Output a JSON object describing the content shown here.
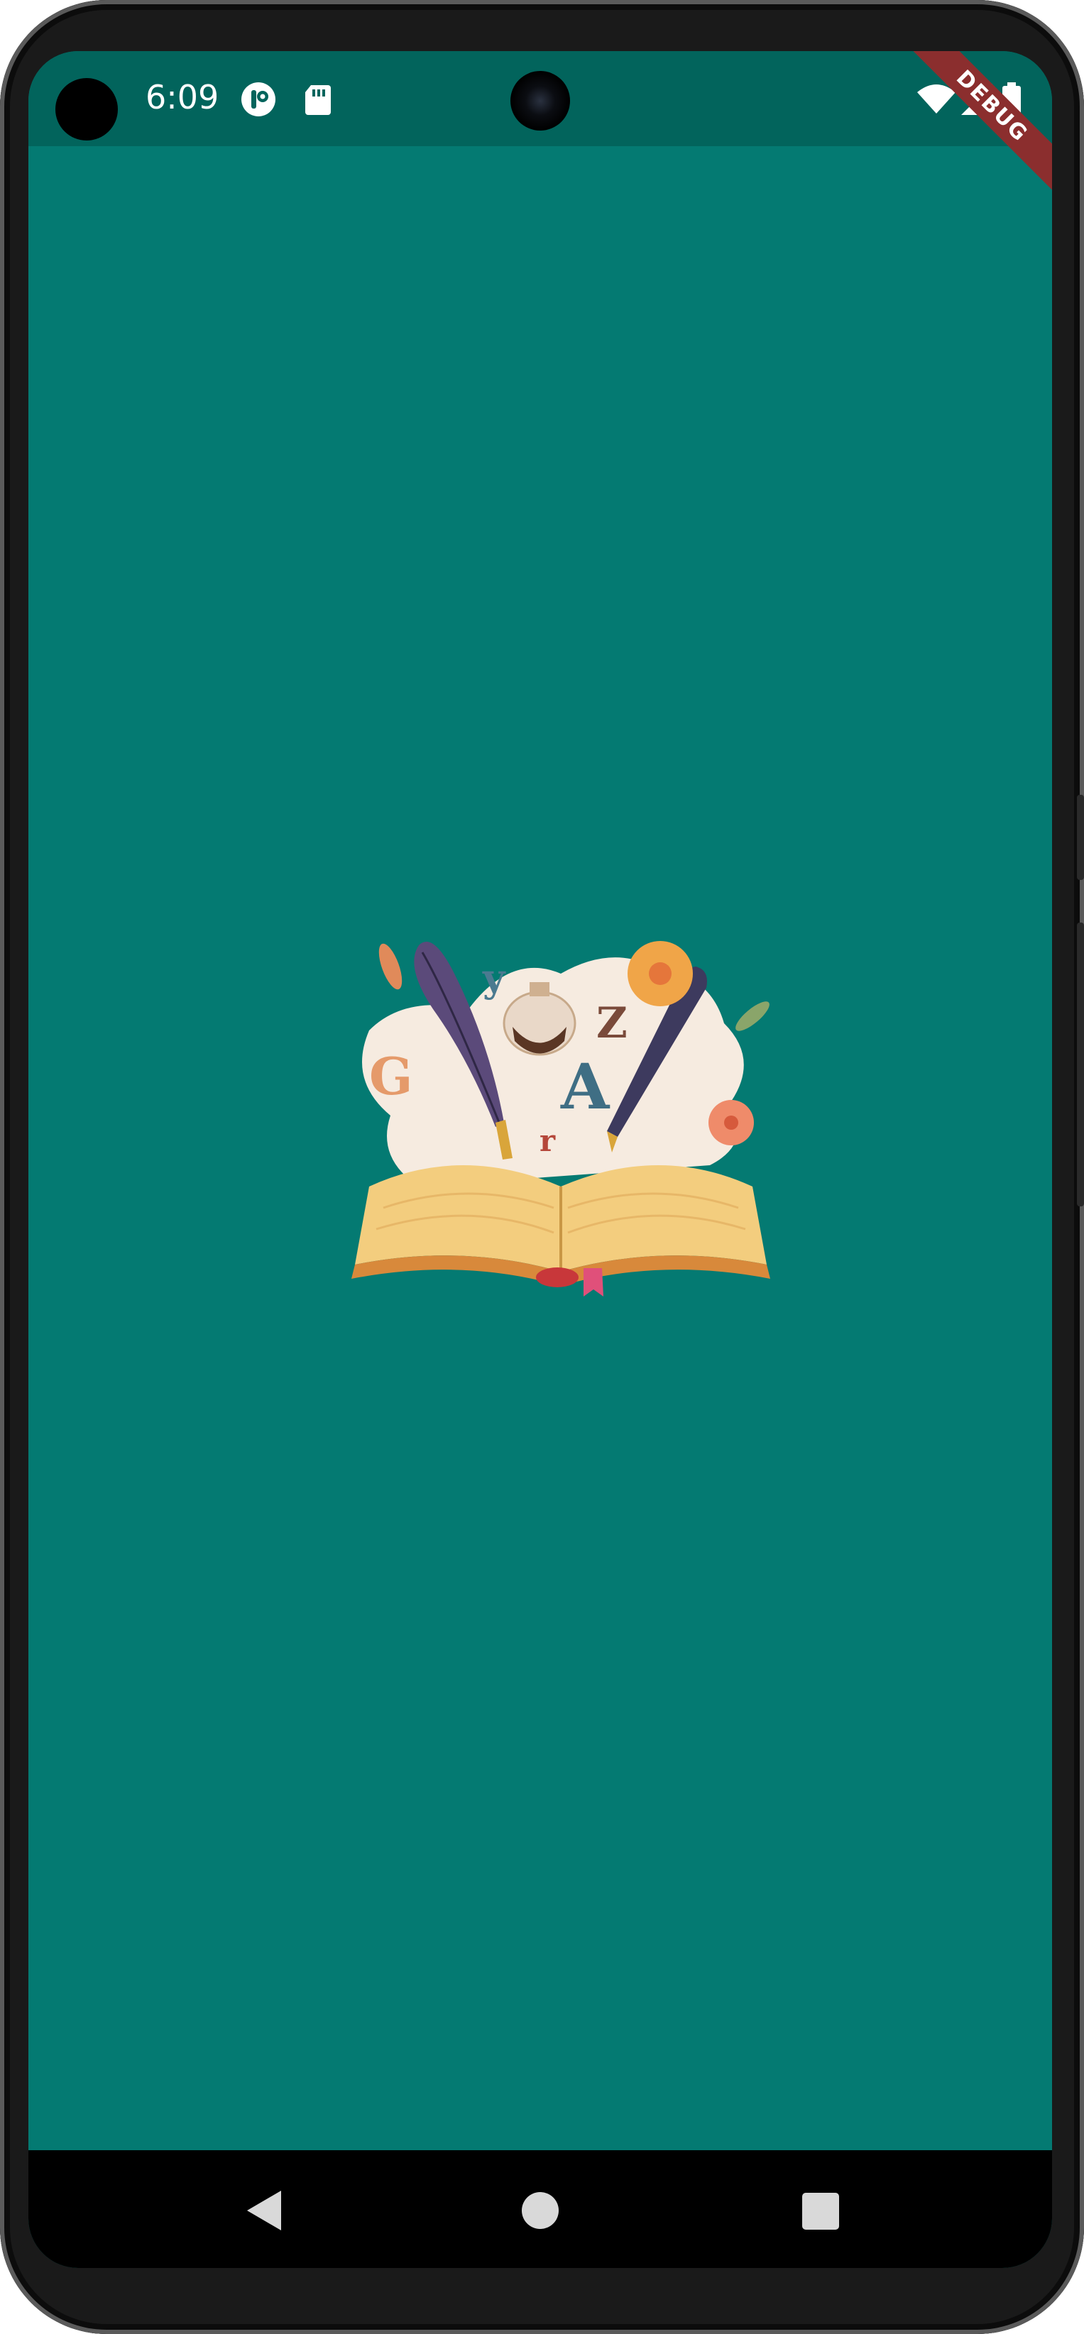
{
  "status_bar": {
    "time": "6:09",
    "icons": [
      "app-notification-icon",
      "sd-card-icon",
      "wifi-icon",
      "signal-icon",
      "battery-icon"
    ],
    "background_color": "#02645c"
  },
  "debug_banner": {
    "label": "DEBUG"
  },
  "screen": {
    "background_color": "#047a72",
    "illustration": {
      "letters": [
        "G",
        "y",
        "Z",
        "A",
        "r"
      ],
      "description_icon": "open-book-quill-pen-illustration"
    }
  },
  "nav_bar": {
    "buttons": [
      "back-icon",
      "home-icon",
      "recents-icon"
    ]
  }
}
